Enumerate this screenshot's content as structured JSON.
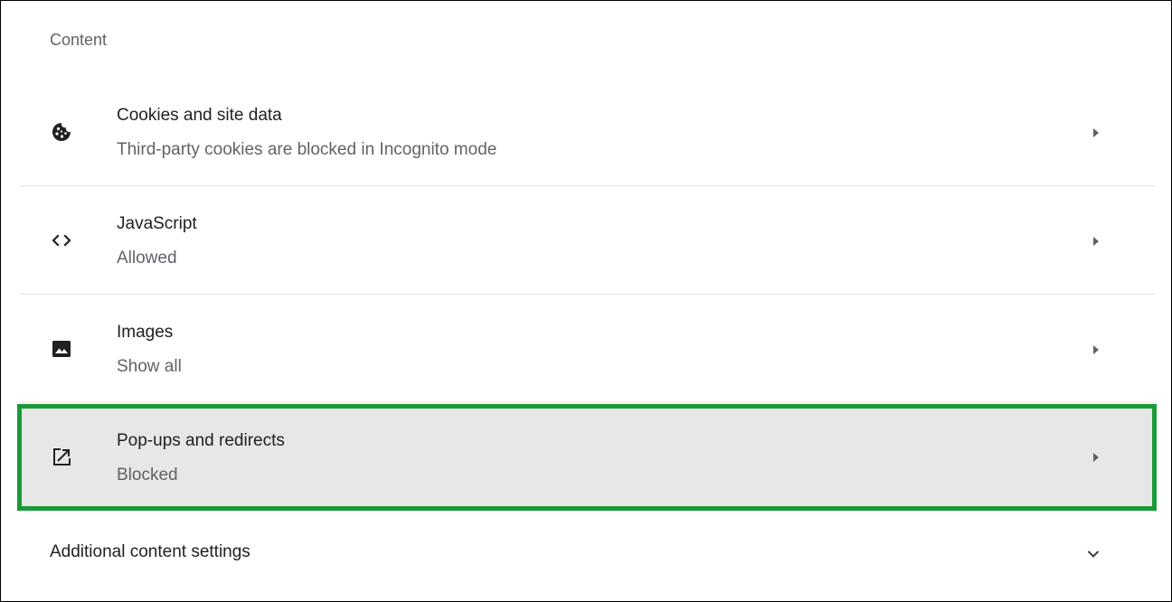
{
  "section": {
    "title": "Content"
  },
  "rows": [
    {
      "title": "Cookies and site data",
      "subtitle": "Third-party cookies are blocked in Incognito mode",
      "icon": "cookie-icon"
    },
    {
      "title": "JavaScript",
      "subtitle": "Allowed",
      "icon": "code-icon"
    },
    {
      "title": "Images",
      "subtitle": "Show all",
      "icon": "image-icon"
    },
    {
      "title": "Pop-ups and redirects",
      "subtitle": "Blocked",
      "icon": "open-in-new-icon",
      "highlighted": true
    }
  ],
  "additional": {
    "label": "Additional content settings",
    "icon": "chevron-down-icon"
  },
  "colors": {
    "highlight_border": "#1a9a36",
    "highlight_background": "#e7e7e7",
    "icon": "#5f6368",
    "text_primary": "#202124",
    "text_secondary": "#5f6368"
  }
}
